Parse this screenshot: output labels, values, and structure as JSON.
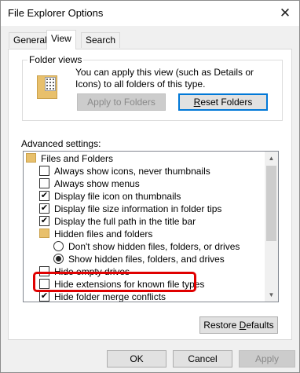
{
  "window": {
    "title": "File Explorer Options",
    "close_glyph": "✕"
  },
  "tabs": [
    {
      "label": "General",
      "active": false
    },
    {
      "label": "View",
      "active": true
    },
    {
      "label": "Search",
      "active": false
    }
  ],
  "folder_views": {
    "label": "Folder views",
    "description": "You can apply this view (such as Details or Icons) to all folders of this type.",
    "apply_button": "Apply to Folders",
    "reset_button_prefix": "R",
    "reset_button_rest": "eset Folders"
  },
  "advanced": {
    "label": "Advanced settings:",
    "items": [
      {
        "kind": "folder",
        "label": "Files and Folders"
      },
      {
        "kind": "checkbox",
        "checked": false,
        "label": "Always show icons, never thumbnails"
      },
      {
        "kind": "checkbox",
        "checked": false,
        "label": "Always show menus"
      },
      {
        "kind": "checkbox",
        "checked": true,
        "label": "Display file icon on thumbnails"
      },
      {
        "kind": "checkbox",
        "checked": true,
        "label": "Display file size information in folder tips"
      },
      {
        "kind": "checkbox",
        "checked": true,
        "label": "Display the full path in the title bar"
      },
      {
        "kind": "folder",
        "label": "Hidden files and folders"
      },
      {
        "kind": "radio",
        "checked": false,
        "label": "Don't show hidden files, folders, or drives"
      },
      {
        "kind": "radio",
        "checked": true,
        "label": "Show hidden files, folders, and drives"
      },
      {
        "kind": "checkbox",
        "checked": false,
        "label": "Hide empty drives"
      },
      {
        "kind": "checkbox",
        "checked": false,
        "label": "Hide extensions for known file types"
      },
      {
        "kind": "checkbox",
        "checked": true,
        "label": "Hide folder merge conflicts"
      }
    ]
  },
  "restore_button_prefix": "Restore ",
  "restore_button_u": "D",
  "restore_button_rest": "efaults",
  "footer": {
    "ok": "OK",
    "cancel": "Cancel",
    "apply": "Apply"
  },
  "colors": {
    "highlight": "#e00000",
    "accent": "#0078d7",
    "folder": "#e8c06c"
  }
}
